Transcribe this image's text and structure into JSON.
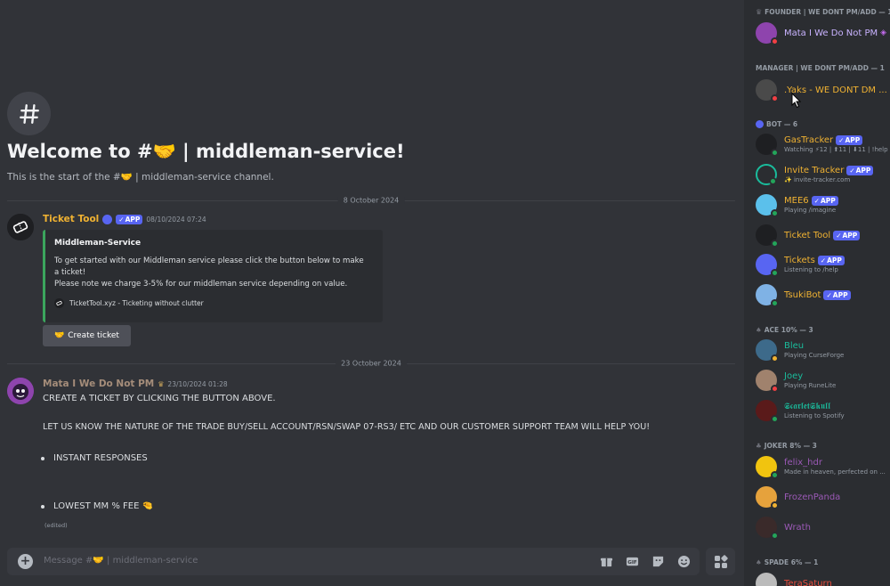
{
  "channel": {
    "welcome_title": "Welcome to #🤝 | middleman-service!",
    "welcome_sub": "This is the start of the #🤝 | middleman-service channel."
  },
  "dividers": [
    "8 October 2024",
    "23 October 2024"
  ],
  "messages": [
    {
      "author": "Ticket Tool",
      "author_color": "#f0b232",
      "badge": "APP",
      "timestamp": "08/10/2024 07:24",
      "embed": {
        "title": "Middleman-Service",
        "desc_1": "To get started with our Middleman service please click the button below to make",
        "desc_2": "a ticket!",
        "desc_3": "Please note we charge 3-5% for our middleman service depending on value.",
        "footer": "TicketTool.xyz - Ticketing without clutter"
      },
      "button": "Create ticket",
      "button_emoji": "🤝"
    },
    {
      "author": "Mata I We Do Not PM",
      "author_color": "#a58d7a",
      "crown": "♛",
      "timestamp": "23/10/2024 01:28",
      "line_1": "CREATE A TICKET BY CLICKING THE BUTTON ABOVE.",
      "line_2": "LET US KNOW THE NATURE OF THE TRADE BUY/SELL ACCOUNT/RSN/SWAP 07-RS3/ ETC AND OUR CUSTOMER SUPPORT TEAM WILL HELP YOU!",
      "bullet_1": "INSTANT RESPONSES",
      "bullet_2": "LOWEST MM % FEE 🤏",
      "edited": "(edited)"
    }
  ],
  "composer": {
    "placeholder": "Message #🤝 | middleman-service"
  },
  "members": {
    "sections": [
      {
        "label": "FOUNDER  |  WE DONT PM/ADD — 1"
      },
      {
        "label": "MANAGER  |  WE DONT PM/ADD — 1"
      },
      {
        "label": "BOT — 6"
      },
      {
        "label": "ACE 10% — 3"
      },
      {
        "label": "JOKER 8% — 3"
      },
      {
        "label": "SPADE 6% — 1"
      }
    ],
    "list": [
      {
        "name": "Mata I We Do Not PM",
        "activity": "",
        "color": "#c9b3ff",
        "app": false
      },
      {
        "name": ".Yaks - WE DONT DM ...",
        "activity": "",
        "color": "#f0b232",
        "app": false
      },
      {
        "name": "GasTracker",
        "activity": "Watching ⚡12 | ⬆11 | ⬇11 | !help",
        "color": "#f0b232",
        "app": true
      },
      {
        "name": "Invite Tracker",
        "activity": "✨ invite-tracker.com",
        "color": "#f0b232",
        "app": true
      },
      {
        "name": "MEE6",
        "activity": "Playing /imagine",
        "color": "#f0b232",
        "app": true
      },
      {
        "name": "Ticket Tool",
        "activity": "",
        "color": "#f0b232",
        "app": true
      },
      {
        "name": "Tickets",
        "activity": "Listening to /help",
        "color": "#f0b232",
        "app": true
      },
      {
        "name": "TsukiBot",
        "activity": "",
        "color": "#f0b232",
        "app": true
      },
      {
        "name": "Bleu",
        "activity": "Playing CurseForge",
        "color": "#1abc9c",
        "app": false
      },
      {
        "name": "Joey",
        "activity": "Playing RuneLite",
        "color": "#1abc9c",
        "app": false
      },
      {
        "name": "𝕾𝖈𝖆𝖗𝖑𝖊𝖙𝕾𝖐𝖚𝖑𝖑",
        "activity": "Listening to Spotify",
        "color": "#1abc9c",
        "app": false
      },
      {
        "name": "felix_hdr",
        "activity": "Made in heaven, perfected on ...",
        "color": "#9b59b6",
        "app": false
      },
      {
        "name": "FrozenPanda",
        "activity": "",
        "color": "#9b59b6",
        "app": false
      },
      {
        "name": "Wrath",
        "activity": "",
        "color": "#9b59b6",
        "app": false
      },
      {
        "name": "TeraSaturn",
        "activity": "",
        "color": "#e74c3c",
        "app": false
      }
    ],
    "app_badge": "APP"
  }
}
